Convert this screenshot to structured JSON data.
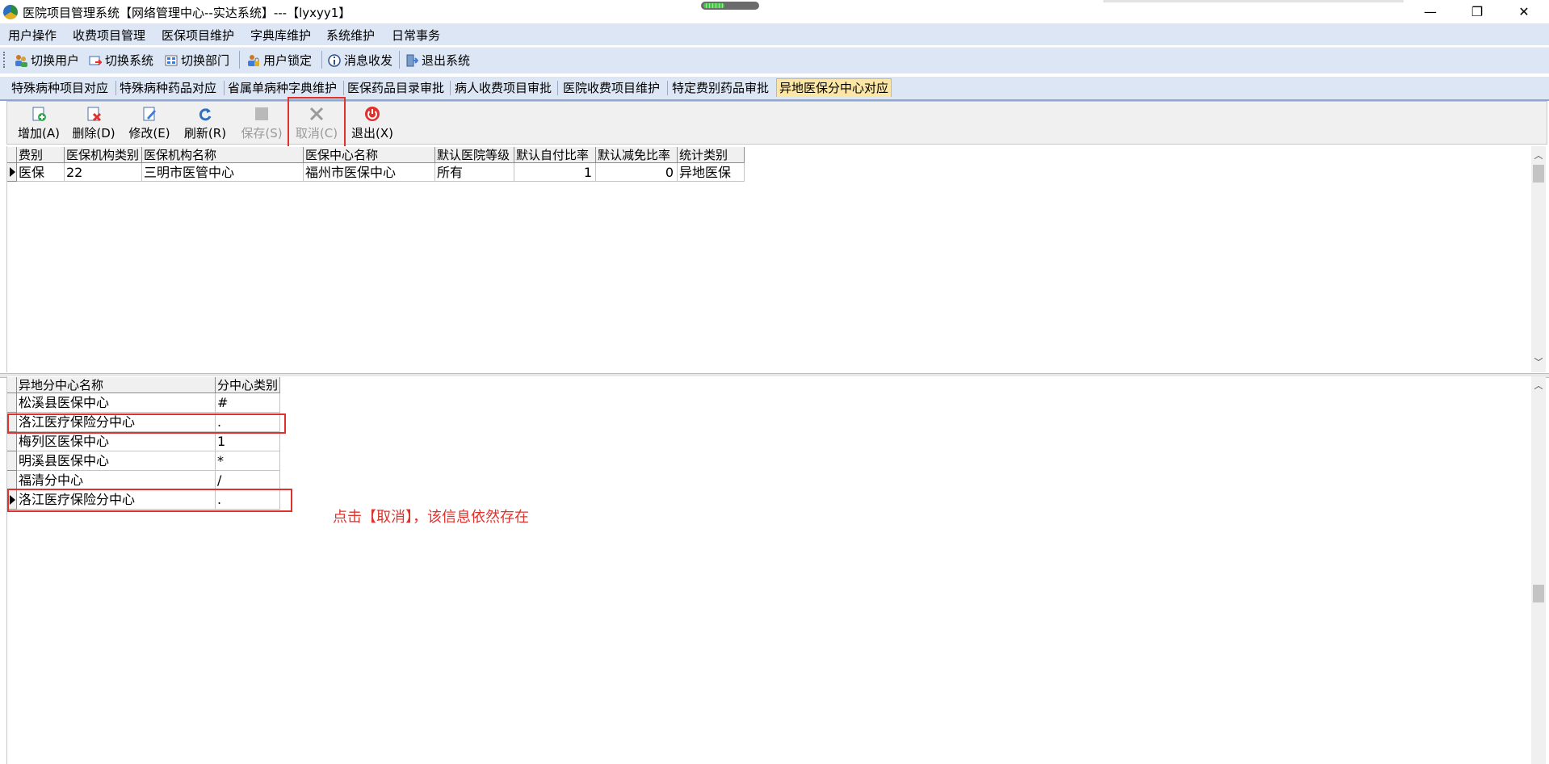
{
  "window": {
    "title": "医院项目管理系统【网络管理中心--实达系统】---【lyxyy1】",
    "minimize_glyph": "—",
    "restore_glyph": "❐",
    "close_glyph": "✕"
  },
  "menu": [
    "用户操作",
    "收费项目管理",
    "医保项目维护",
    "字典库维护",
    "系统维护",
    "日常事务"
  ],
  "toolbar": {
    "switch_user": "切换用户",
    "switch_system": "切换系统",
    "switch_dept": "切换部门",
    "user_lock": "用户锁定",
    "message": "消息收发",
    "exit_system": "退出系统"
  },
  "tabs": [
    "特殊病种项目对应",
    "特殊病种药品对应",
    "省属单病种字典维护",
    "医保药品目录审批",
    "病人收费项目审批",
    "医院收费项目维护",
    "特定费别药品审批",
    "异地医保分中心对应"
  ],
  "active_tab": "异地医保分中心对应",
  "actions": {
    "add": "增加(A)",
    "delete": "删除(D)",
    "edit": "修改(E)",
    "refresh": "刷新(R)",
    "save": "保存(S)",
    "cancel": "取消(C)",
    "exit": "退出(X)"
  },
  "top_grid": {
    "columns": [
      "费别",
      "医保机构类别",
      "医保机构名称",
      "医保中心名称",
      "默认医院等级",
      "默认自付比率",
      "默认减免比率",
      "统计类别"
    ],
    "rows": [
      [
        "医保",
        "22",
        "三明市医管中心",
        "福州市医保中心",
        "所有",
        "1",
        "0",
        "异地医保"
      ]
    ]
  },
  "bottom_grid": {
    "columns": [
      "异地分中心名称",
      "分中心类别"
    ],
    "rows": [
      [
        "松溪县医保中心",
        "#"
      ],
      [
        "洛江医疗保险分中心",
        "."
      ],
      [
        "梅列区医保中心",
        "1"
      ],
      [
        "明溪县医保中心",
        "*"
      ],
      [
        "福清分中心",
        "/"
      ],
      [
        "洛江医疗保险分中心",
        "."
      ]
    ]
  },
  "annotation": "点击【取消】，该信息依然存在",
  "colors": {
    "annotation_red": "#e0322d",
    "bar_bg": "#dde6f5",
    "active_tab_bg": "#fbe6a6"
  }
}
